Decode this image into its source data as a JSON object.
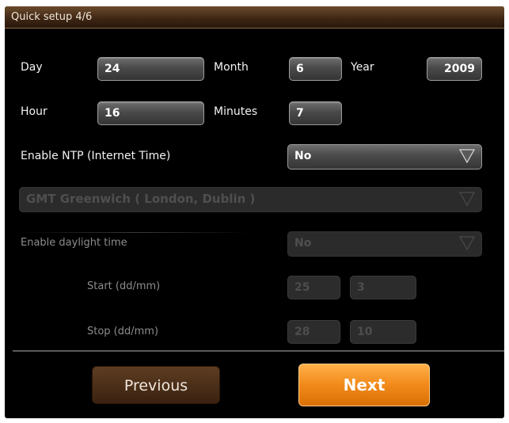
{
  "window": {
    "title": "Quick setup 4/6"
  },
  "date": {
    "day_label": "Day",
    "day_value": "24",
    "month_label": "Month",
    "month_value": "6",
    "year_label": "Year",
    "year_value": "2009"
  },
  "time": {
    "hour_label": "Hour",
    "hour_value": "16",
    "minutes_label": "Minutes",
    "minutes_value": "7"
  },
  "ntp": {
    "label": "Enable NTP (Internet Time)",
    "value": "No"
  },
  "timezone": {
    "value": "GMT Greenwich ( London, Dublin )"
  },
  "daylight": {
    "label": "Enable daylight time",
    "value": "No",
    "start_label": "Start (dd/mm)",
    "start_day": "25",
    "start_month": "3",
    "stop_label": "Stop (dd/mm)",
    "stop_day": "28",
    "stop_month": "10"
  },
  "buttons": {
    "previous": "Previous",
    "next": "Next"
  },
  "colors": {
    "accent": "#f28a1a",
    "titlebar": "#3d2513",
    "background": "#000000"
  },
  "icons": {
    "dropdown": "dropdown-triangle-icon"
  }
}
